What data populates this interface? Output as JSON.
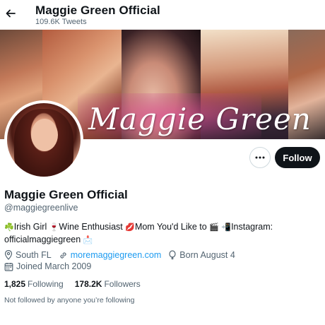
{
  "header": {
    "title": "Maggie Green Official",
    "tweets": "109.6K Tweets"
  },
  "banner": {
    "script_text": "Maggie Green"
  },
  "actions": {
    "follow_label": "Follow"
  },
  "profile": {
    "name": "Maggie Green Official",
    "handle": "@maggiegreenlive",
    "bio_line1_a": "Irish Girl",
    "bio_line1_b": "Wine Enthusiast",
    "bio_line1_c": "Mom You'd Like to",
    "bio_line1_d": "Instagram:",
    "bio_line2": "officialmaggiegreen",
    "location": "South FL",
    "website": "moremaggiegreen.com",
    "born": "Born August 4",
    "joined": "Joined March 2009"
  },
  "stats": {
    "following_count": "1,825",
    "following_label": "Following",
    "followers_count": "178.2K",
    "followers_label": "Followers"
  },
  "social_context": "Not followed by anyone you’re following",
  "icons": [
    "back-arrow-icon",
    "more-icon",
    "location-icon",
    "link-icon",
    "balloon-icon",
    "calendar-icon"
  ],
  "colors": {
    "link": "#1d9bf0",
    "follow_bg": "#0f1419",
    "muted": "#536471"
  }
}
